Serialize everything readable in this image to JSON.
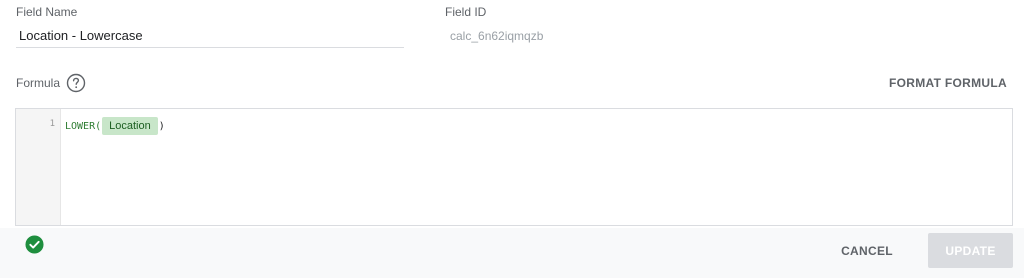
{
  "field_name": {
    "label": "Field Name",
    "value": "Location - Lowercase"
  },
  "field_id": {
    "label": "Field ID",
    "value": "calc_6n62iqmqzb"
  },
  "formula": {
    "label": "Formula",
    "help_icon": "question-circle-icon",
    "format_label": "FORMAT FORMULA",
    "line_number": "1",
    "function": "LOWER(",
    "field_chip": "Location",
    "close_paren": ")"
  },
  "footer": {
    "valid_icon": "check-circle-icon",
    "cancel_label": "CANCEL",
    "update_label": "UPDATE"
  },
  "colors": {
    "valid": "#1e8e3e",
    "chip_bg": "#c8e6c9",
    "function_text": "#2e7d32",
    "update_disabled_bg": "#dadce0"
  }
}
